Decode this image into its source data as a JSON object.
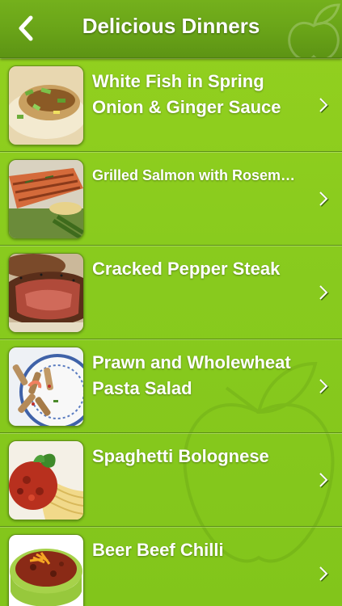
{
  "navbar": {
    "title": "Delicious Dinners",
    "back_icon": "chevron-left-icon",
    "logo_icon": "apple-leaf-icon"
  },
  "recipes": [
    {
      "title": "White Fish in Spring Onion & Ginger Sauce",
      "thumb_icon": "fish-dish-image"
    },
    {
      "title": "Grilled Salmon with Rosem…",
      "thumb_icon": "salmon-dish-image"
    },
    {
      "title": "Cracked Pepper Steak",
      "thumb_icon": "steak-dish-image"
    },
    {
      "title": "Prawn and Wholewheat Pasta Salad",
      "thumb_icon": "pasta-salad-image"
    },
    {
      "title": "Spaghetti Bolognese",
      "thumb_icon": "spaghetti-image"
    },
    {
      "title": "Beer Beef Chilli",
      "thumb_icon": "chilli-bowl-image"
    }
  ],
  "colors": {
    "navbar": "#6ba619",
    "background": "#8acb1e",
    "text": "#ffffff"
  }
}
